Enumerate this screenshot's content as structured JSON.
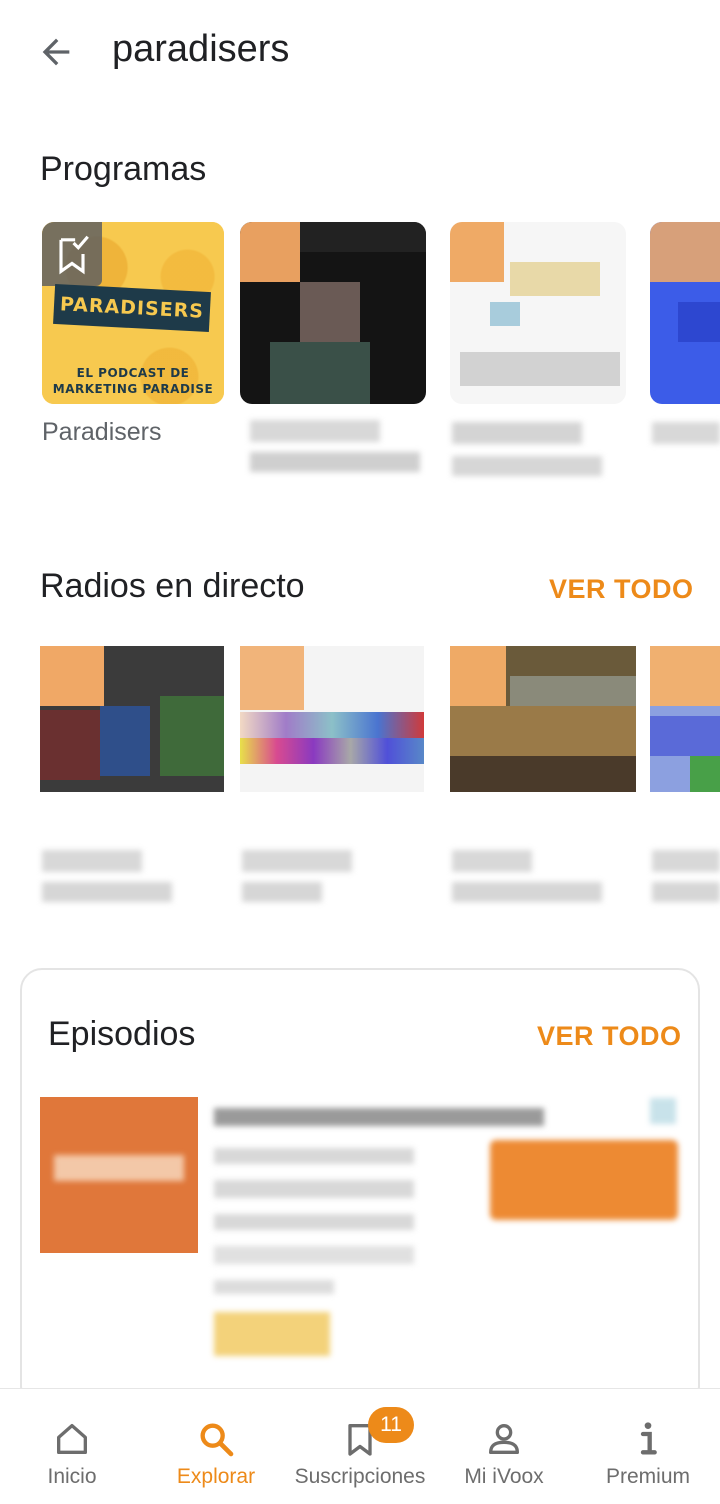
{
  "header": {
    "search_query": "paradisers",
    "back_icon": "arrow-left-icon"
  },
  "programs": {
    "section_title": "Programas",
    "items": [
      {
        "title": "Paradisers",
        "cover_text_main": "PARADISERS",
        "cover_text_line1": "EL PODCAST DE",
        "cover_text_line2": "MARKETING PARADISE",
        "badge_icon": "bookmark-check-icon"
      }
    ]
  },
  "radios": {
    "section_title": "Radios en directo",
    "see_all_label": "VER TODO"
  },
  "episodes": {
    "section_title": "Episodios",
    "see_all_label": "VER TODO"
  },
  "bottom_nav": {
    "items": [
      {
        "label": "Inicio",
        "icon": "home-icon",
        "active": false
      },
      {
        "label": "Explorar",
        "icon": "search-icon",
        "active": true
      },
      {
        "label": "Suscripciones",
        "icon": "subscriptions-icon",
        "active": false,
        "badge": "11"
      },
      {
        "label": "Mi iVoox",
        "icon": "person-icon",
        "active": false
      },
      {
        "label": "Premium",
        "icon": "info-icon",
        "active": false
      }
    ]
  },
  "colors": {
    "accent": "#ed8a19",
    "text_primary": "#202124",
    "text_secondary": "#6d6d6d"
  }
}
